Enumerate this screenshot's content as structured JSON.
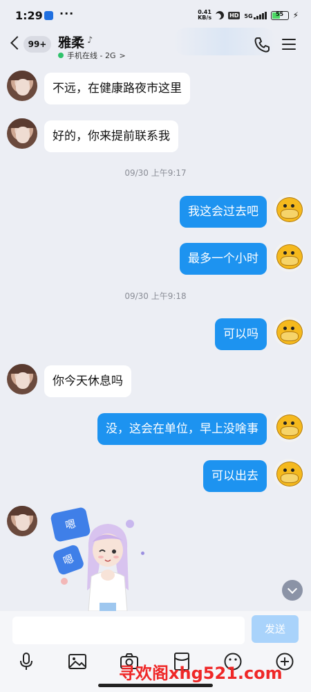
{
  "status_bar": {
    "time": "1:29",
    "speed_value": "0.41",
    "speed_unit": "KB/s",
    "hd": "HD",
    "signal": "5G",
    "battery": "55",
    "battery_level": 0.55
  },
  "header": {
    "unread_badge": "99+",
    "contact_name": "雅柔",
    "online_status": "手机在线 - 2G",
    "online_arrow": ">"
  },
  "timestamps": [
    "09/30 上午9:17",
    "09/30 上午9:18"
  ],
  "messages": [
    {
      "from": "contact",
      "text": "不远，在健康路夜市这里"
    },
    {
      "from": "contact",
      "text": "好的，你来提前联系我"
    },
    {
      "from": "me",
      "text": "我这会过去吧"
    },
    {
      "from": "me",
      "text": "最多一个小时"
    },
    {
      "from": "me",
      "text": "可以吗"
    },
    {
      "from": "contact",
      "text": "你今天休息吗"
    },
    {
      "from": "me",
      "text": "没，这会在单位，早上没啥事"
    },
    {
      "from": "me",
      "text": "可以出去"
    }
  ],
  "sticker": {
    "text1": "嗯",
    "text2": "嗯"
  },
  "input": {
    "placeholder": "",
    "send_label": "发送"
  },
  "toolbar": {
    "icons": [
      "microphone-icon",
      "image-icon",
      "camera-icon",
      "red-packet-icon",
      "emoji-icon",
      "plus-icon"
    ]
  },
  "watermark": "寻欢阁xhg521.com",
  "colors": {
    "outgoing_bubble": "#1d93f0",
    "incoming_bubble": "#ffffff",
    "background": "#eceef4",
    "send_button": "#a9d3fb",
    "watermark": "#ef2727"
  }
}
